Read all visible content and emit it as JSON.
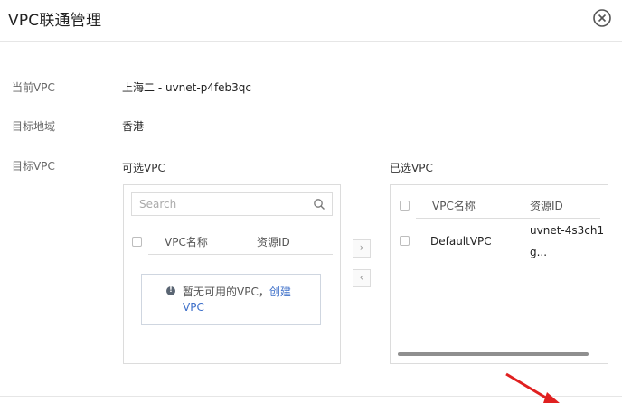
{
  "dialog": {
    "title": "VPC联通管理",
    "close_icon": "close-circle-icon"
  },
  "form": {
    "current_vpc_label": "当前VPC",
    "current_vpc_value": "上海二 - uvnet-p4feb3qc",
    "target_region_label": "目标地域",
    "target_region_value": "香港",
    "target_vpc_label": "目标VPC"
  },
  "available": {
    "title": "可选VPC",
    "search_placeholder": "Search",
    "col_name": "VPC名称",
    "col_id": "资源ID",
    "empty_text": "暂无可用的VPC，",
    "create_link": "创建",
    "empty_text2": "VPC"
  },
  "transfer": {
    "right_arrow": "›",
    "left_arrow": "‹"
  },
  "selected": {
    "title": "已选VPC",
    "col_name": "VPC名称",
    "col_id": "资源ID",
    "rows": [
      {
        "name": "DefaultVPC",
        "id_line1": "uvnet-4s3ch1",
        "id_line2": "g..."
      }
    ]
  },
  "colors": {
    "link": "#3d6fc9",
    "annotation_arrow": "#e02020"
  }
}
